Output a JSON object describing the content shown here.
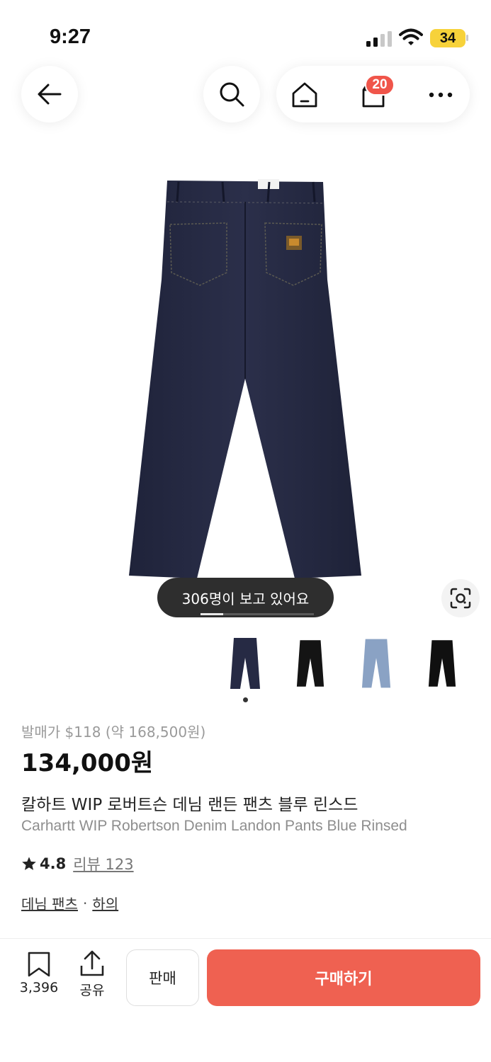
{
  "status_bar": {
    "time": "9:27",
    "battery": "34",
    "icons": [
      "cellular-signal-icon",
      "wifi-icon",
      "battery-icon"
    ]
  },
  "nav": {
    "back_icon": "arrow-left-icon",
    "search_icon": "search-icon",
    "home_icon": "home-icon",
    "cart_icon": "shopping-bag-icon",
    "cart_count": "20",
    "more_icon": "more-horizontal-icon"
  },
  "media": {
    "viewers_text": "306명이 보고 있어요",
    "gallery_progress": 0.2,
    "lens_icon": "image-search-icon",
    "thumbnails": [
      {
        "name": "navy-denim",
        "color": "#262a44"
      },
      {
        "name": "black",
        "color": "#141414"
      },
      {
        "name": "light-blue",
        "color": "#8aa2c4"
      },
      {
        "name": "black-alt",
        "color": "#101010"
      }
    ]
  },
  "product": {
    "original_price": "발매가 $118 (약 168,500원)",
    "price": "134,000원",
    "title_ko": "칼하트 WIP 로버트슨 데님 랜든 팬츠 블루 린스드",
    "title_en": "Carhartt WIP Robertson Denim Landon Pants Blue Rinsed",
    "rating": "4.8",
    "review_label": "리뷰 123",
    "category_1": "데님 팬츠",
    "category_sep": "·",
    "category_2": "하의"
  },
  "bottom_bar": {
    "bookmark_count": "3,396",
    "share_label": "공유",
    "sell_label": "판매",
    "buy_label": "구매하기",
    "buy_color": "#ef6151"
  },
  "colors": {
    "accent": "#ef6151",
    "badge": "#f0554a",
    "battery": "#f7d23a",
    "denim": "#262a44"
  }
}
